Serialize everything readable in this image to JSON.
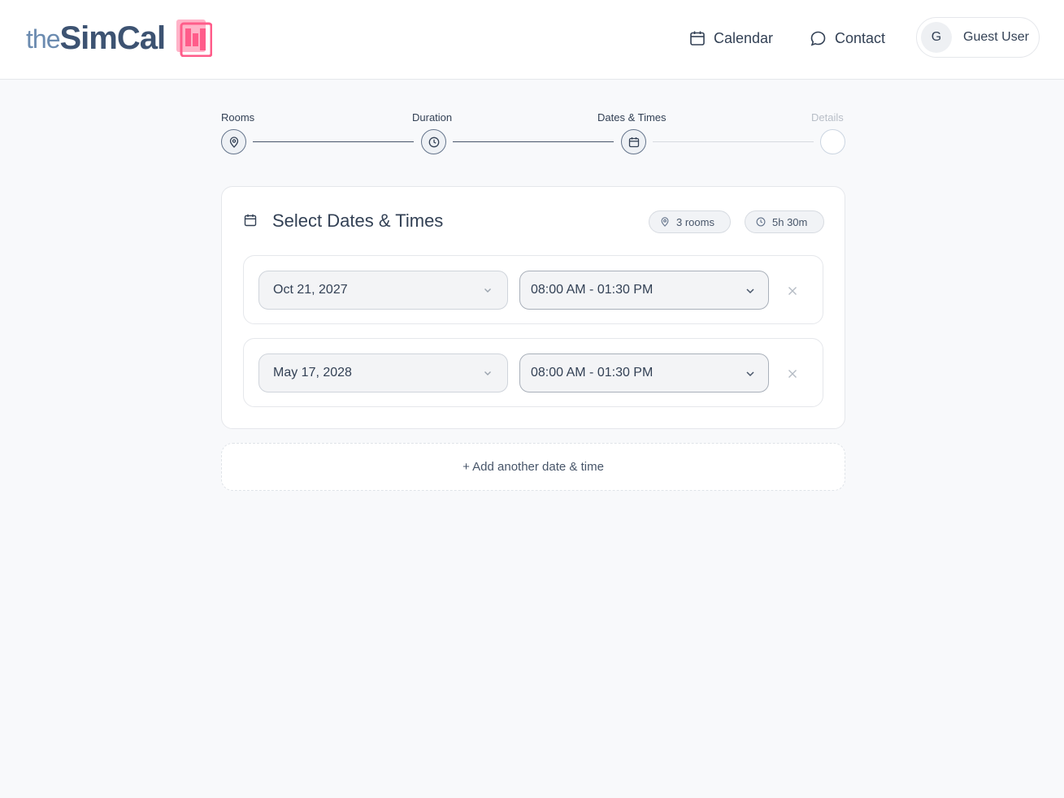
{
  "brand": {
    "prefix": "the",
    "name": "SimCal",
    "colors": {
      "prefix": "#6b8bb0",
      "name": "#3d5372",
      "mark": "#ff5c8a"
    }
  },
  "nav": {
    "calendar": {
      "label": "Calendar",
      "icon": "calendar-icon"
    },
    "contact": {
      "label": "Contact",
      "icon": "chat-bubble-icon"
    }
  },
  "user": {
    "initial": "G",
    "name": "Guest User"
  },
  "stepper": {
    "steps": [
      {
        "label": "Rooms",
        "icon": "map-pin-icon",
        "state": "complete"
      },
      {
        "label": "Duration",
        "icon": "clock-icon",
        "state": "complete"
      },
      {
        "label": "Dates & Times",
        "icon": "calendar-icon",
        "state": "current"
      },
      {
        "label": "Details",
        "icon": "",
        "state": "pending"
      }
    ]
  },
  "card": {
    "title": "Select Dates & Times",
    "chips": {
      "rooms": "3 rooms",
      "duration": "5h 30m"
    },
    "rows": [
      {
        "date": "Oct 21, 2027",
        "time": "08:00 AM - 01:30 PM"
      },
      {
        "date": "May 17, 2028",
        "time": "08:00 AM - 01:30 PM"
      }
    ]
  },
  "add_button": {
    "label": "+ Add another date & time"
  }
}
